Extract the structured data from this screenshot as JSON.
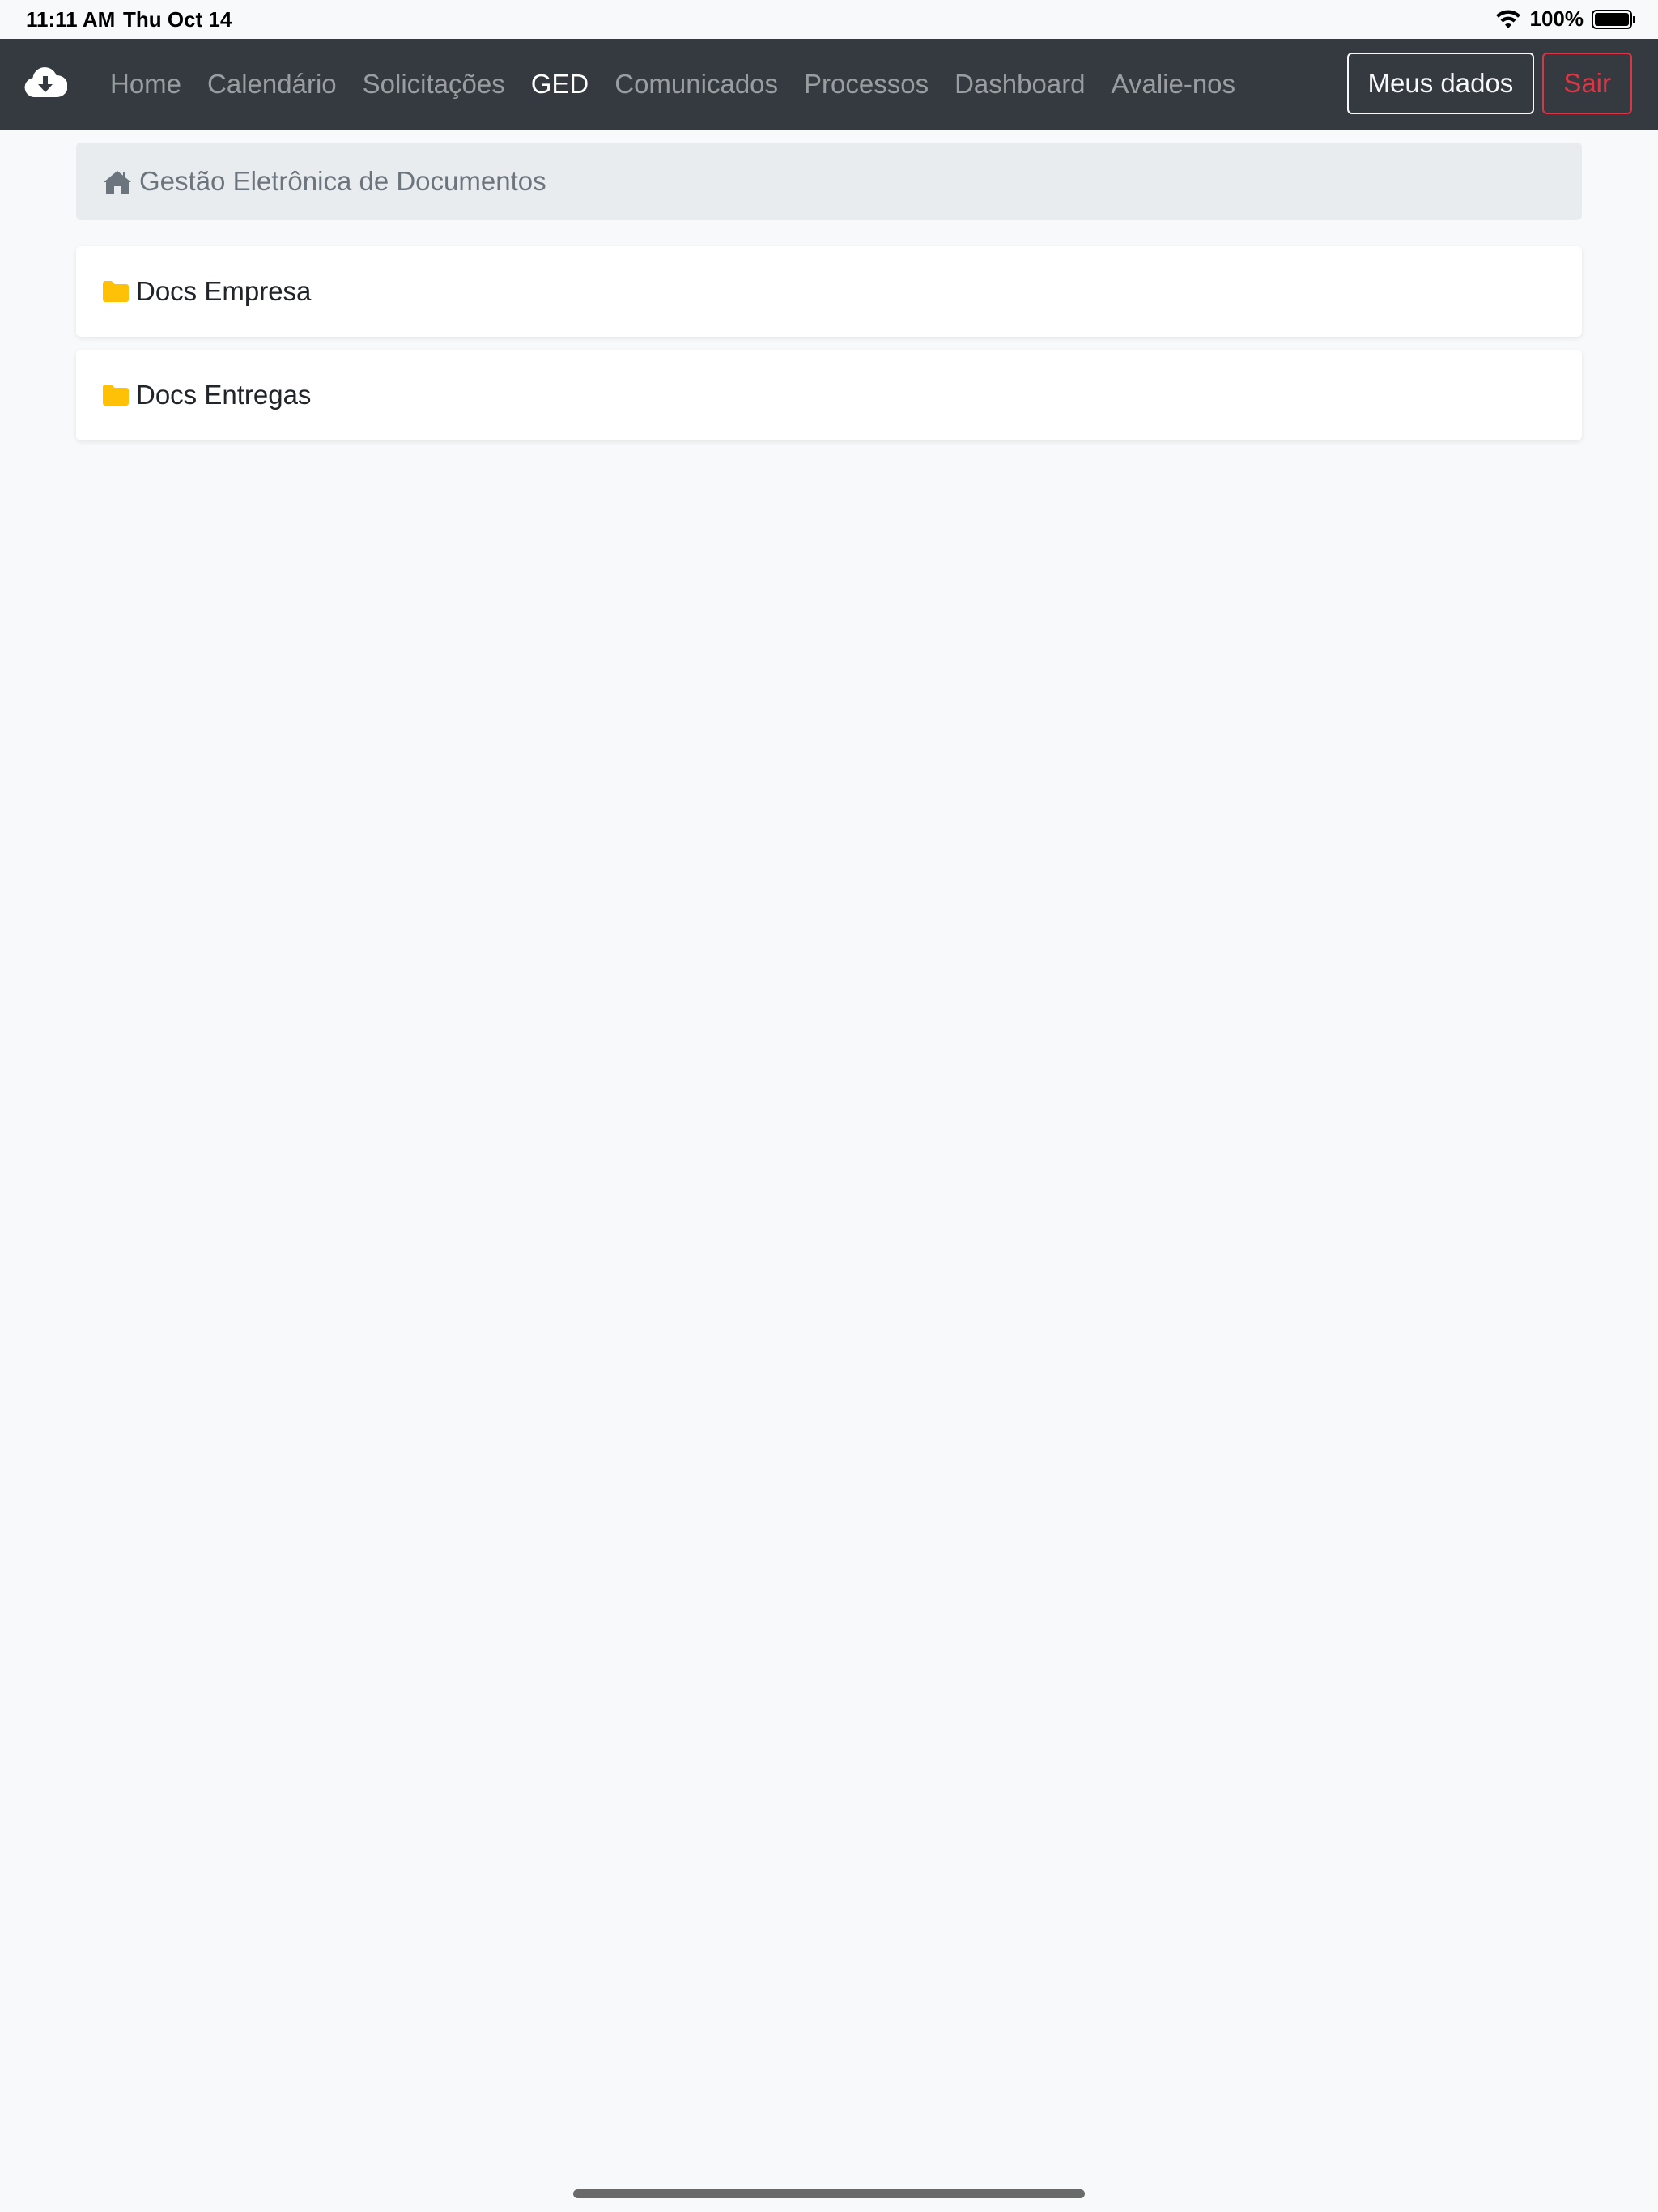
{
  "status_bar": {
    "time": "11:11 AM",
    "date": "Thu Oct 14",
    "battery": "100%"
  },
  "navbar": {
    "brand_icon": "cloud-download-icon",
    "links": [
      {
        "label": "Home",
        "active": false
      },
      {
        "label": "Calendário",
        "active": false
      },
      {
        "label": "Solicitações",
        "active": false
      },
      {
        "label": "GED",
        "active": true
      },
      {
        "label": "Comunicados",
        "active": false
      },
      {
        "label": "Processos",
        "active": false
      },
      {
        "label": "Dashboard",
        "active": false
      },
      {
        "label": "Avalie-nos",
        "active": false
      }
    ],
    "my_data_label": "Meus dados",
    "logout_label": "Sair"
  },
  "breadcrumb": {
    "icon": "home-icon",
    "title": "Gestão Eletrônica de Documentos"
  },
  "folders": [
    {
      "icon": "folder-icon",
      "label": "Docs Empresa"
    },
    {
      "icon": "folder-icon",
      "label": "Docs Entregas"
    }
  ],
  "colors": {
    "navbar_bg": "#343a40",
    "danger": "#dc3545",
    "folder": "#ffc107",
    "breadcrumb_bg": "#e9ecef",
    "page_bg": "#f8f9fa"
  }
}
